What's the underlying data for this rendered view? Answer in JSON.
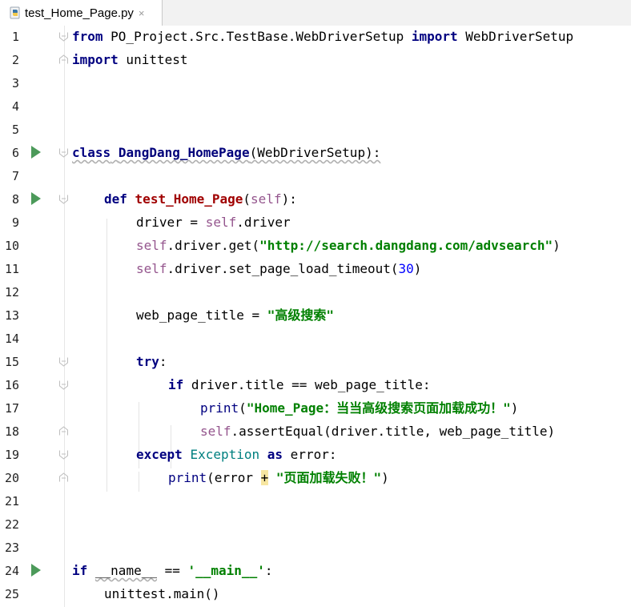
{
  "tab": {
    "filename": "test_Home_Page.py",
    "close_symbol": "×",
    "file_icon": "python-file-icon"
  },
  "lines": {
    "l1": {
      "num": "1",
      "t1": "from",
      "t2": " PO_Project.Src.TestBase.WebDriverSetup ",
      "t3": "import",
      "t4": " WebDriverSetup"
    },
    "l2": {
      "num": "2",
      "t1": "import",
      "t2": " unittest"
    },
    "l3": {
      "num": "3"
    },
    "l4": {
      "num": "4"
    },
    "l5": {
      "num": "5"
    },
    "l6": {
      "num": "6",
      "t1": "class",
      "t2": " ",
      "t3": "DangDang_HomePage",
      "t4": "(WebDriverSetup):"
    },
    "l7": {
      "num": "7"
    },
    "l8": {
      "num": "8",
      "t1": "def",
      "t2": " ",
      "t3": "test_Home_Page",
      "t4": "(",
      "t5": "self",
      "t6": "):"
    },
    "l9": {
      "num": "9",
      "t1": "driver = ",
      "t2": "self",
      "t3": ".driver"
    },
    "l10": {
      "num": "10",
      "t1": "self",
      "t2": ".driver.get(",
      "t3": "\"http://search.dangdang.com/advsearch\"",
      "t4": ")"
    },
    "l11": {
      "num": "11",
      "t1": "self",
      "t2": ".driver.set_page_load_timeout(",
      "t3": "30",
      "t4": ")"
    },
    "l12": {
      "num": "12"
    },
    "l13": {
      "num": "13",
      "t1": "web_page_title = ",
      "t2": "\"高级搜索\""
    },
    "l14": {
      "num": "14"
    },
    "l15": {
      "num": "15",
      "t1": "try",
      "t2": ":"
    },
    "l16": {
      "num": "16",
      "t1": "if",
      "t2": " driver.title == web_page_title:"
    },
    "l17": {
      "num": "17",
      "t1": "print",
      "t2": "(",
      "t3": "\"Home_Page：当当高级搜索页面加载成功！\"",
      "t4": ")"
    },
    "l18": {
      "num": "18",
      "t1": "self",
      "t2": ".assertEqual(driver.title, web_page_title)"
    },
    "l19": {
      "num": "19",
      "t1": "except",
      "t2": " ",
      "t3": "Exception",
      "t4": " ",
      "t5": "as",
      "t6": " error:"
    },
    "l20": {
      "num": "20",
      "t1": "print",
      "t2": "(error ",
      "t3": "+",
      "t4": " ",
      "t5": "\"页面加载失败！\"",
      "t6": ")"
    },
    "l21": {
      "num": "21"
    },
    "l22": {
      "num": "22"
    },
    "l23": {
      "num": "23"
    },
    "l24": {
      "num": "24",
      "t1": "if",
      "t2": " ",
      "t3": "__name__",
      "t4": " == ",
      "t5": "'__main__'",
      "t6": ":"
    },
    "l25": {
      "num": "25",
      "t1": "unittest.main()"
    }
  },
  "colors": {
    "keyword": "#000080",
    "string": "#008000",
    "self": "#94558d",
    "number": "#0000ff",
    "function": "#a00000",
    "run_icon": "#4c9a5a"
  }
}
